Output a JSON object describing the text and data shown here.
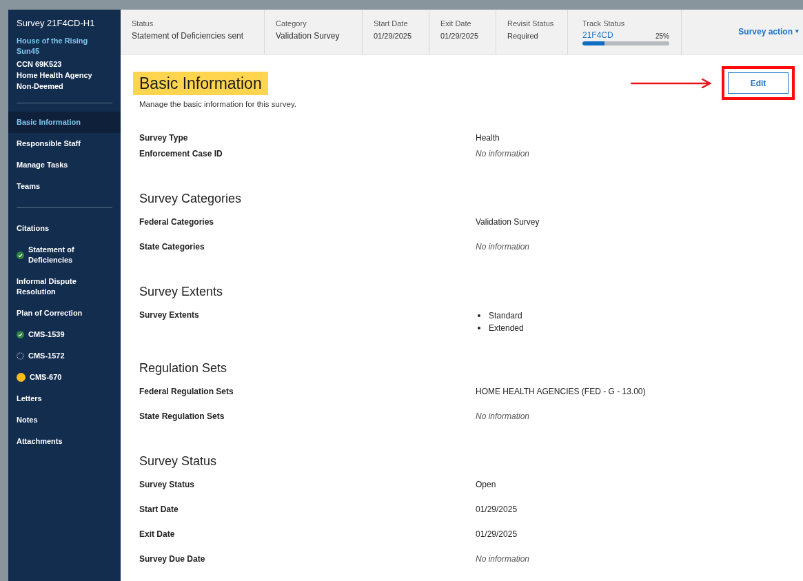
{
  "sidebar": {
    "title": "Survey 21F4CD-H1",
    "facility": "House of the Rising Sun45",
    "details": [
      "CCN 69K523",
      "Home Health Agency",
      "Non-Deemed"
    ],
    "groups": [
      {
        "items": [
          {
            "label": "Basic Information",
            "selected": true
          },
          {
            "label": "Responsible Staff",
            "selected": false
          },
          {
            "label": "Manage Tasks",
            "selected": false
          },
          {
            "label": "Teams",
            "selected": false
          }
        ]
      },
      {
        "items": [
          {
            "label": "Citations",
            "selected": false
          },
          {
            "label": "Statement of Deficiencies",
            "selected": false,
            "kind": "complete"
          },
          {
            "label": "Informal Dispute Resolution",
            "selected": false
          },
          {
            "label": "Plan of Correction",
            "selected": false
          },
          {
            "label": "CMS-1539",
            "selected": false,
            "kind": "complete"
          },
          {
            "label": "CMS-1572",
            "selected": false,
            "kind": "pending"
          },
          {
            "label": "CMS-670",
            "selected": false,
            "kind": "progress"
          },
          {
            "label": "Letters",
            "selected": false
          },
          {
            "label": "Notes",
            "selected": false
          },
          {
            "label": "Attachments",
            "selected": false
          }
        ]
      }
    ]
  },
  "header": {
    "fields": [
      {
        "label": "Status",
        "value": "Statement of Deficiencies sent"
      },
      {
        "label": "Category",
        "value": "Validation Survey"
      },
      {
        "label": "Start Date",
        "value": "01/29/2025"
      },
      {
        "label": "Exit Date",
        "value": "01/29/2025"
      },
      {
        "label": "Revisit Status",
        "value": "Required"
      }
    ],
    "track": {
      "label": "Track Status",
      "link": "21F4CD",
      "percent": "25%",
      "level": 0.25
    },
    "action": {
      "label": "Survey action",
      "caret": "▾"
    }
  },
  "page": {
    "title": "Basic Information",
    "subtitle": "Manage the basic information for this survey.",
    "edit_button": {
      "label": "Edit",
      "highlighted": true
    },
    "sections": [
      {
        "rows": [
          {
            "label": "Survey Type",
            "kind": "text",
            "value": "Health"
          },
          {
            "label": "Enforcement Case ID",
            "kind": "empty",
            "value": "No information"
          }
        ]
      },
      {
        "heading": "Survey Categories",
        "rows": [
          {
            "label": "Federal Categories",
            "kind": "text",
            "value": "Validation Survey"
          },
          {
            "label": "State Categories",
            "kind": "empty",
            "value": "No information"
          }
        ]
      },
      {
        "heading": "Survey Extents",
        "rows": [
          {
            "label": "Survey Extents",
            "kind": "list",
            "values": [
              "Standard",
              "Extended"
            ]
          }
        ]
      },
      {
        "heading": "Regulation Sets",
        "rows": [
          {
            "label": "Federal Regulation Sets",
            "kind": "text",
            "value": "HOME HEALTH AGENCIES (FED - G - 13.00)"
          },
          {
            "label": "State Regulation Sets",
            "kind": "empty",
            "value": "No information"
          }
        ]
      },
      {
        "heading": "Survey Status",
        "rows": [
          {
            "label": "Survey Status",
            "kind": "text",
            "value": "Open"
          },
          {
            "label": "Start Date",
            "kind": "text",
            "value": "01/29/2025"
          },
          {
            "label": "Exit Date",
            "kind": "text",
            "value": "01/29/2025"
          },
          {
            "label": "Survey Due Date",
            "kind": "empty",
            "value": "No information"
          }
        ]
      }
    ]
  }
}
